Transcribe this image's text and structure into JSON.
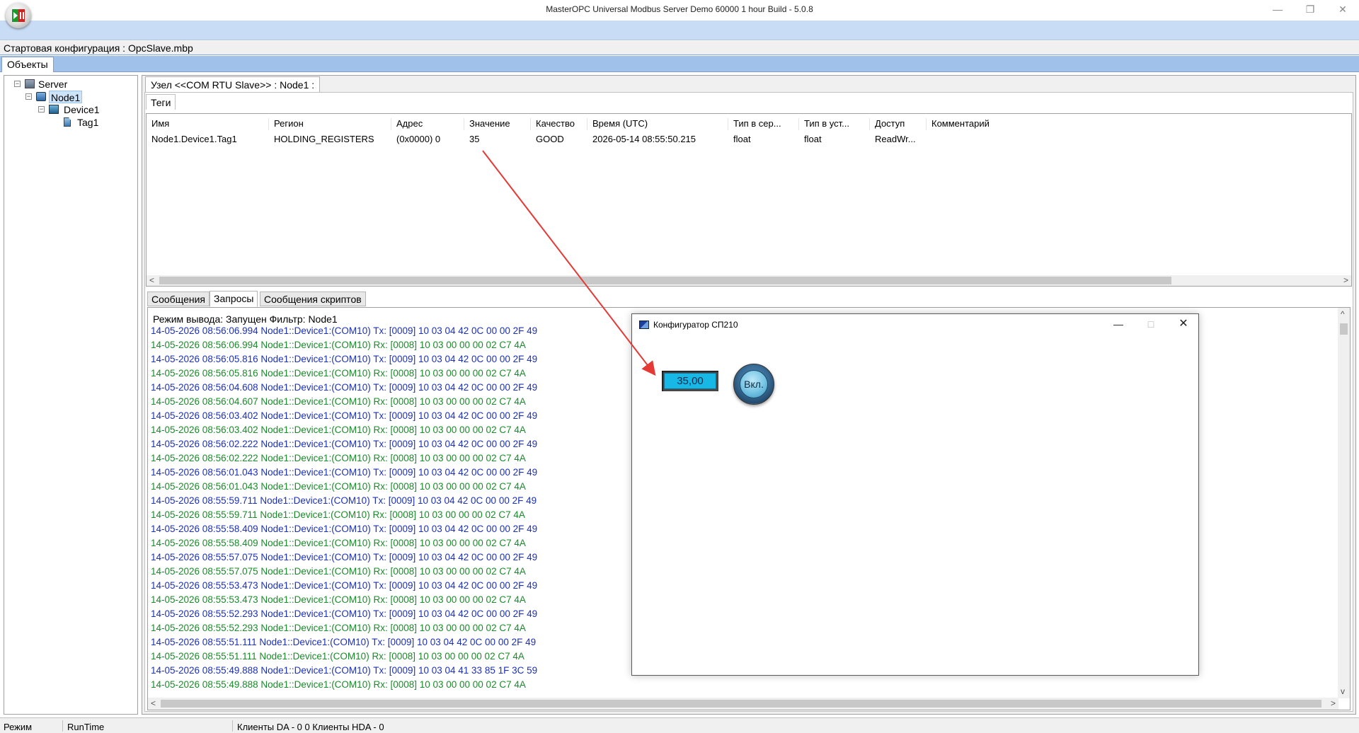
{
  "window": {
    "title": "MasterOPC Universal Modbus Server Demo 60000 1 hour Build - 5.0.8",
    "minimize": "—",
    "restore": "❐",
    "close": "✕"
  },
  "config_bar": {
    "label": "Стартовая конфигурация : OpcSlave.mbp"
  },
  "objects_tab": {
    "label": "Объекты"
  },
  "tree": {
    "server": "Server",
    "node": "Node1",
    "device": "Device1",
    "tag": "Tag1",
    "expanded": "−"
  },
  "node_tab": {
    "label": "Узел <<COM RTU Slave>> : Node1 :"
  },
  "tags_tab": {
    "label": "Теги"
  },
  "tags_table": {
    "headers": [
      "Имя",
      "Регион",
      "Адрес",
      "Значение",
      "Качество",
      "Время (UTC)",
      "Тип в сер...",
      "Тип в уст...",
      "Доступ",
      "Комментарий"
    ],
    "rows": [
      [
        "Node1.Device1.Tag1",
        "HOLDING_REGISTERS",
        "(0x0000) 0",
        "35",
        "GOOD",
        "2026-05-14 08:55:50.215",
        "float",
        "float",
        "ReadWr...",
        ""
      ]
    ]
  },
  "scroll": {
    "left": "<",
    "right": ">",
    "up": "^",
    "down": "v"
  },
  "bottom_tabs": [
    "Сообщения",
    "Запросы",
    "Сообщения скриптов"
  ],
  "log": {
    "header": "Режим вывода: Запущен Фильтр: Node1",
    "lines": [
      {
        "dir": "tx",
        "text": "14-05-2026 08:56:06.994 Node1::Device1:(COM10) Tx: [0009] 10 03 04 42 0C 00 00 2F 49"
      },
      {
        "dir": "rx",
        "text": "14-05-2026 08:56:06.994 Node1::Device1:(COM10) Rx: [0008] 10 03 00 00 00 02 C7 4A"
      },
      {
        "dir": "tx",
        "text": "14-05-2026 08:56:05.816 Node1::Device1:(COM10) Tx: [0009] 10 03 04 42 0C 00 00 2F 49"
      },
      {
        "dir": "rx",
        "text": "14-05-2026 08:56:05.816 Node1::Device1:(COM10) Rx: [0008] 10 03 00 00 00 02 C7 4A"
      },
      {
        "dir": "tx",
        "text": "14-05-2026 08:56:04.608 Node1::Device1:(COM10) Tx: [0009] 10 03 04 42 0C 00 00 2F 49"
      },
      {
        "dir": "rx",
        "text": "14-05-2026 08:56:04.607 Node1::Device1:(COM10) Rx: [0008] 10 03 00 00 00 02 C7 4A"
      },
      {
        "dir": "tx",
        "text": "14-05-2026 08:56:03.402 Node1::Device1:(COM10) Tx: [0009] 10 03 04 42 0C 00 00 2F 49"
      },
      {
        "dir": "rx",
        "text": "14-05-2026 08:56:03.402 Node1::Device1:(COM10) Rx: [0008] 10 03 00 00 00 02 C7 4A"
      },
      {
        "dir": "tx",
        "text": "14-05-2026 08:56:02.222 Node1::Device1:(COM10) Tx: [0009] 10 03 04 42 0C 00 00 2F 49"
      },
      {
        "dir": "rx",
        "text": "14-05-2026 08:56:02.222 Node1::Device1:(COM10) Rx: [0008] 10 03 00 00 00 02 C7 4A"
      },
      {
        "dir": "tx",
        "text": "14-05-2026 08:56:01.043 Node1::Device1:(COM10) Tx: [0009] 10 03 04 42 0C 00 00 2F 49"
      },
      {
        "dir": "rx",
        "text": "14-05-2026 08:56:01.043 Node1::Device1:(COM10) Rx: [0008] 10 03 00 00 00 02 C7 4A"
      },
      {
        "dir": "tx",
        "text": "14-05-2026 08:55:59.711 Node1::Device1:(COM10) Tx: [0009] 10 03 04 42 0C 00 00 2F 49"
      },
      {
        "dir": "rx",
        "text": "14-05-2026 08:55:59.711 Node1::Device1:(COM10) Rx: [0008] 10 03 00 00 00 02 C7 4A"
      },
      {
        "dir": "tx",
        "text": "14-05-2026 08:55:58.409 Node1::Device1:(COM10) Tx: [0009] 10 03 04 42 0C 00 00 2F 49"
      },
      {
        "dir": "rx",
        "text": "14-05-2026 08:55:58.409 Node1::Device1:(COM10) Rx: [0008] 10 03 00 00 00 02 C7 4A"
      },
      {
        "dir": "tx",
        "text": "14-05-2026 08:55:57.075 Node1::Device1:(COM10) Tx: [0009] 10 03 04 42 0C 00 00 2F 49"
      },
      {
        "dir": "rx",
        "text": "14-05-2026 08:55:57.075 Node1::Device1:(COM10) Rx: [0008] 10 03 00 00 00 02 C7 4A"
      },
      {
        "dir": "tx",
        "text": "14-05-2026 08:55:53.473 Node1::Device1:(COM10) Tx: [0009] 10 03 04 42 0C 00 00 2F 49"
      },
      {
        "dir": "rx",
        "text": "14-05-2026 08:55:53.473 Node1::Device1:(COM10) Rx: [0008] 10 03 00 00 00 02 C7 4A"
      },
      {
        "dir": "tx",
        "text": "14-05-2026 08:55:52.293 Node1::Device1:(COM10) Tx: [0009] 10 03 04 42 0C 00 00 2F 49"
      },
      {
        "dir": "rx",
        "text": "14-05-2026 08:55:52.293 Node1::Device1:(COM10) Rx: [0008] 10 03 00 00 00 02 C7 4A"
      },
      {
        "dir": "tx",
        "text": "14-05-2026 08:55:51.111 Node1::Device1:(COM10) Tx: [0009] 10 03 04 42 0C 00 00 2F 49"
      },
      {
        "dir": "rx",
        "text": "14-05-2026 08:55:51.111 Node1::Device1:(COM10) Rx: [0008] 10 03 00 00 00 02 C7 4A"
      },
      {
        "dir": "tx",
        "text": "14-05-2026 08:55:49.888 Node1::Device1:(COM10) Tx: [0009] 10 03 04 41 33 85 1F 3C 59"
      },
      {
        "dir": "rx",
        "text": "14-05-2026 08:55:49.888 Node1::Device1:(COM10) Rx: [0008] 10 03 00 00 00 02 C7 4A"
      }
    ]
  },
  "configurator": {
    "title": "Конфигуратор СП210",
    "minimize": "—",
    "maximize": "□",
    "close": "✕",
    "value": "35,00",
    "toggle_label": "Вкл."
  },
  "status": {
    "mode_label": "Режим",
    "mode_value": "RunTime",
    "clients": "Клиенты DA - 0 0 Клиенты HDA - 0"
  },
  "colors": {
    "tx": "#1c30b8",
    "rx": "#1b8a2a",
    "arrow": "#e53935",
    "value_display": "#17b7e6"
  }
}
